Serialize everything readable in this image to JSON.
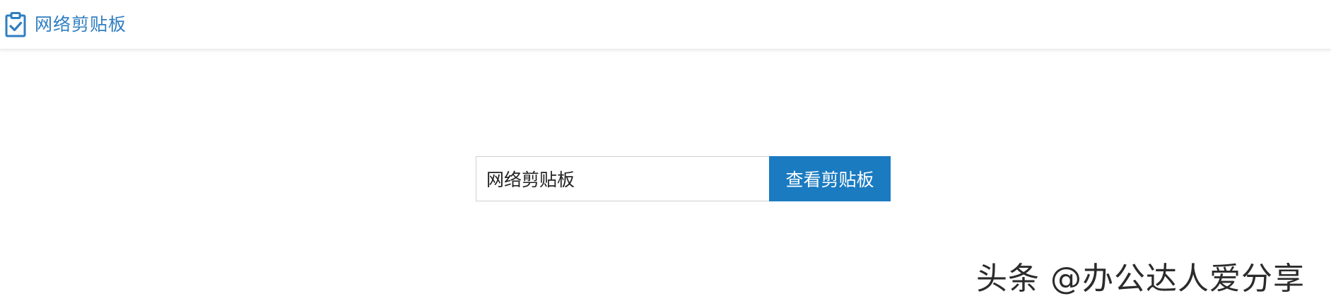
{
  "navbar": {
    "brand_label": "网络剪贴板",
    "brand_icon": "clipboard-check-icon",
    "brand_color": "#2f7ec0"
  },
  "search": {
    "value": "网络剪贴板",
    "button_label": "查看剪贴板",
    "button_color": "#1b7bc1"
  },
  "watermark": {
    "text": "头条 @办公达人爱分享"
  }
}
